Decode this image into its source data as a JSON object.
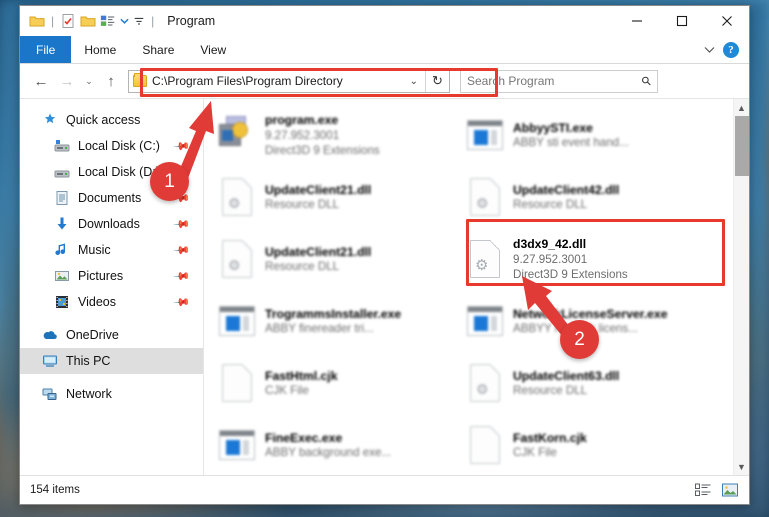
{
  "window": {
    "title": "Program",
    "quick_access_icons": [
      "folder-icon",
      "properties-icon",
      "new-folder-icon",
      "customize-icon",
      "dropdown-icon"
    ],
    "controls": {
      "minimize": "minimize-button",
      "maximize": "maximize-button",
      "close": "close-button"
    }
  },
  "ribbon": {
    "tabs": [
      {
        "label": "File",
        "active": true
      },
      {
        "label": "Home",
        "active": false
      },
      {
        "label": "Share",
        "active": false
      },
      {
        "label": "View",
        "active": false
      }
    ],
    "collapse_icon": "chevron-down-icon",
    "help_label": "?"
  },
  "nav": {
    "back": "←",
    "forward": "→",
    "recent": "⌄",
    "up": "↑",
    "address_value": "C:\\Program Files\\Program Directory",
    "address_chevron": "⌄",
    "refresh": "↻"
  },
  "search": {
    "placeholder": "Search Program",
    "value": "",
    "icon": "search-icon"
  },
  "sidebar": {
    "items": [
      {
        "label": "Quick access",
        "icon": "star-pin-icon",
        "indent": false,
        "pinned": false,
        "selected": false
      },
      {
        "label": "Local Disk (C:)",
        "icon": "drive-icon",
        "indent": true,
        "pinned": true,
        "selected": false
      },
      {
        "label": "Local Disk (D:)",
        "icon": "drive-icon",
        "indent": true,
        "pinned": true,
        "selected": false
      },
      {
        "label": "Documents",
        "icon": "documents-icon",
        "indent": true,
        "pinned": true,
        "selected": false
      },
      {
        "label": "Downloads",
        "icon": "download-icon",
        "indent": true,
        "pinned": true,
        "selected": false
      },
      {
        "label": "Music",
        "icon": "music-icon",
        "indent": true,
        "pinned": true,
        "selected": false
      },
      {
        "label": "Pictures",
        "icon": "pictures-icon",
        "indent": true,
        "pinned": true,
        "selected": false
      },
      {
        "label": "Videos",
        "icon": "videos-icon",
        "indent": true,
        "pinned": true,
        "selected": false
      },
      {
        "label": "OneDrive",
        "icon": "onedrive-icon",
        "indent": false,
        "pinned": false,
        "selected": false
      },
      {
        "label": "This PC",
        "icon": "this-pc-icon",
        "indent": false,
        "pinned": false,
        "selected": true
      },
      {
        "label": "Network",
        "icon": "network-icon",
        "indent": false,
        "pinned": false,
        "selected": false
      }
    ]
  },
  "files": [
    {
      "name": "program.exe",
      "version": "9.27.952.3001",
      "description": "Direct3D 9 Extensions",
      "icon": "program-icon",
      "blurred": true,
      "highlighted": false
    },
    {
      "name": "AbbyySTI.exe",
      "version": "",
      "description": "ABBY sti event hand...",
      "icon": "app-icon",
      "blurred": true,
      "highlighted": false
    },
    {
      "name": "UpdateClient21.dll",
      "version": "",
      "description": "Resource DLL",
      "icon": "dll-icon",
      "blurred": true,
      "highlighted": false
    },
    {
      "name": "UpdateClient42.dll",
      "version": "",
      "description": "Resource DLL",
      "icon": "dll-icon",
      "blurred": true,
      "highlighted": false
    },
    {
      "name": "UpdateClient21.dll",
      "version": "",
      "description": "Resource DLL",
      "icon": "dll-icon",
      "blurred": true,
      "highlighted": false
    },
    {
      "name": "d3dx9_42.dll",
      "version": "9.27.952.3001",
      "description": "Direct3D 9 Extensions",
      "icon": "dll-gear-icon",
      "blurred": false,
      "highlighted": true
    },
    {
      "name": "TrogrammsInstaller.exe",
      "version": "",
      "description": "ABBY finereader tri...",
      "icon": "app-icon",
      "blurred": true,
      "highlighted": false
    },
    {
      "name": "NetworkLicenseServer.exe",
      "version": "",
      "description": "ABBYY network licens...",
      "icon": "app-icon",
      "blurred": true,
      "highlighted": false
    },
    {
      "name": "FastHtml.cjk",
      "version": "",
      "description": "CJK File",
      "icon": "blank-file-icon",
      "blurred": true,
      "highlighted": false
    },
    {
      "name": "UpdateClient63.dll",
      "version": "",
      "description": "Resource DLL",
      "icon": "dll-icon",
      "blurred": true,
      "highlighted": false
    },
    {
      "name": "FineExec.exe",
      "version": "",
      "description": "ABBY background exe...",
      "icon": "app-icon",
      "blurred": true,
      "highlighted": false
    },
    {
      "name": "FastKorn.cjk",
      "version": "",
      "description": "CJK File",
      "icon": "blank-file-icon",
      "blurred": true,
      "highlighted": false
    }
  ],
  "statusbar": {
    "item_count": "154 items",
    "view_details_icon": "details-view-icon",
    "view_thumbnails_icon": "thumbnail-view-icon"
  },
  "annotations": [
    {
      "id": "1",
      "label": "1",
      "target": "address-bar"
    },
    {
      "id": "2",
      "label": "2",
      "target": "d3dx9_42-dll-file"
    }
  ],
  "colors": {
    "accent": "#1976c8",
    "annotation_red": "#e8392f",
    "selection_gray": "#dededf"
  }
}
